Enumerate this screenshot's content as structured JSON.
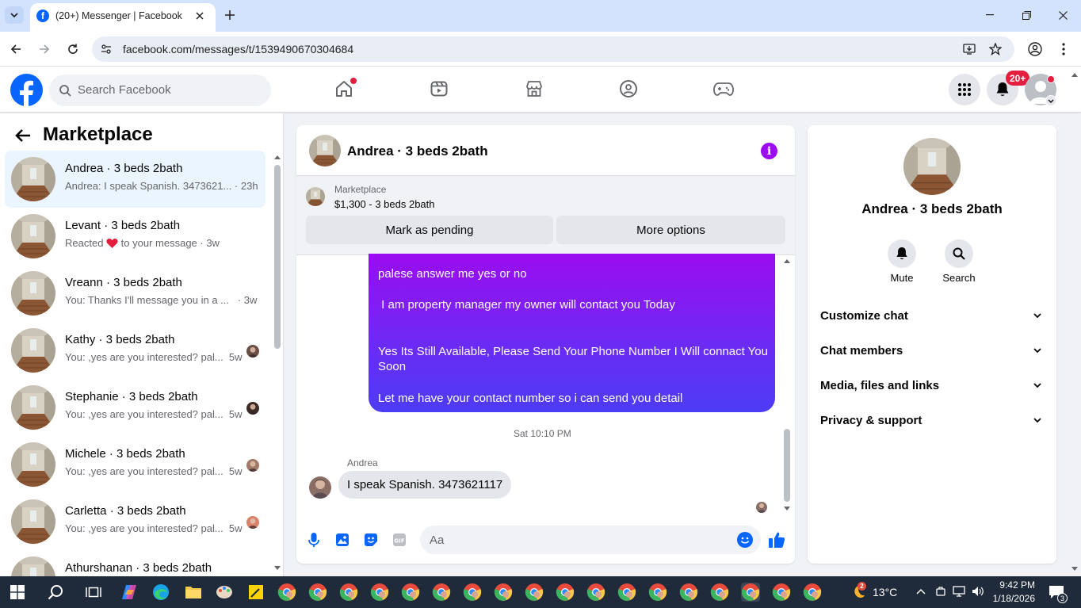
{
  "browser": {
    "tab_title": "(20+) Messenger | Facebook",
    "url": "facebook.com/messages/t/1539490670304684"
  },
  "header": {
    "search_placeholder": "Search Facebook",
    "notifications_badge": "20+"
  },
  "left": {
    "title": "Marketplace",
    "conversations": [
      {
        "name": "Andrea · 3 beds 2bath",
        "preview": "Andrea: I speak Spanish. 3473621... · 23h"
      },
      {
        "name": "Levant · 3 beds 2bath",
        "preview_a": "Reacted",
        "preview_b": "to your message · 3w"
      },
      {
        "name": "Vreann · 3 beds 2bath",
        "preview": "You: Thanks I'll message you in a ...   · 3w"
      },
      {
        "name": "Kathy · 3 beds 2bath",
        "preview": "You: ,yes are you interested? pal...  5w"
      },
      {
        "name": "Stephanie · 3 beds 2bath",
        "preview": "You: ,yes are you interested? pal...  5w"
      },
      {
        "name": "Michele · 3 beds 2bath",
        "preview": "You: ,yes are you interested? pal...  5w"
      },
      {
        "name": "Carletta · 3 beds 2bath",
        "preview": "You: ,yes are you interested? pal...  5w"
      },
      {
        "name": "Athurshanan · 3 beds 2bath",
        "preview": ""
      }
    ]
  },
  "chat": {
    "title": "Andrea · 3 beds 2bath",
    "listing_label": "Marketplace",
    "listing_detail": "$1,300 - 3 beds 2bath",
    "mark_pending": "Mark as pending",
    "more_options": "More options",
    "sent_lines": [
      "palese answer me yes or no",
      " I am property manager my owner will contact you Today",
      "Yes Its Still Available, Please Send Your Phone Number I Will connact You",
      "Soon",
      "Let me have your contact number so i can send you detail"
    ],
    "timestamp": "Sat 10:10 PM",
    "sender_name": "Andrea",
    "received": "I speak Spanish. 3473621117",
    "composer_placeholder": "Aa"
  },
  "details": {
    "name": "Andrea · 3 beds 2bath",
    "mute": "Mute",
    "search": "Search",
    "sections": [
      "Customize chat",
      "Chat members",
      "Media, files and links",
      "Privacy & support"
    ]
  },
  "taskbar": {
    "temp": "13°C",
    "time": "9:42 PM",
    "date": "1/18/2026",
    "weather_badge": "2",
    "notif_count": "3"
  },
  "colors": {
    "fb_blue": "#0866ff",
    "accent_purple": "#9b0cf0",
    "badge_red": "#e41e3f"
  }
}
